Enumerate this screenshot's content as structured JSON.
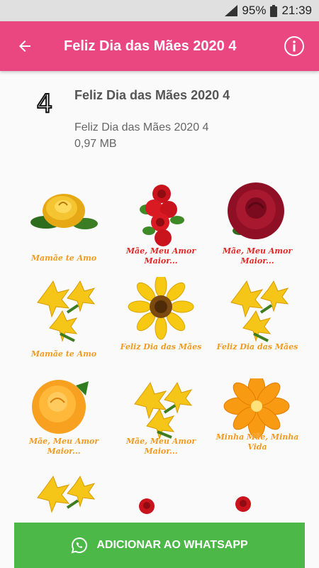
{
  "status": {
    "battery": "95%",
    "time": "21:39"
  },
  "app_bar": {
    "title": "Feliz Dia das Mães 2020 4"
  },
  "pack": {
    "tray_label": "4",
    "name": "Feliz Dia das Mães 2020 4",
    "publisher": "Feliz Dia das Mães 2020 4",
    "size": "0,97 MB"
  },
  "stickers": [
    {
      "image": "yellow-rose",
      "caption": "Mamãe te Amo"
    },
    {
      "image": "red-roses-bouquet",
      "caption": "Mãe, Meu Amor Maior..."
    },
    {
      "image": "dark-red-rose",
      "caption": "Mãe, Meu Amor Maior..."
    },
    {
      "image": "yellow-lilies",
      "caption": "Mamãe te Amo"
    },
    {
      "image": "sunflower",
      "caption": "Feliz Dia das Mães"
    },
    {
      "image": "yellow-lilies",
      "caption": "Feliz Dia das Mães"
    },
    {
      "image": "orange-rose",
      "caption": "Mãe, Meu Amor Maior..."
    },
    {
      "image": "yellow-lilies",
      "caption": "Mãe, Meu Amor Maior..."
    },
    {
      "image": "orange-flower",
      "caption": "Minha Mãe, Minha Vida"
    },
    {
      "image": "yellow-lilies",
      "caption": ""
    },
    {
      "image": "small-red-rose",
      "caption": ""
    },
    {
      "image": "small-red-rose",
      "caption": ""
    }
  ],
  "button": {
    "label": "ADICIONAR AO WHATSAPP",
    "icon": "whatsapp-icon"
  },
  "colors": {
    "app_bar": "#ea4780",
    "button": "#4cb847",
    "caption_orange": "#f29a1f",
    "caption_red": "#e22727"
  }
}
